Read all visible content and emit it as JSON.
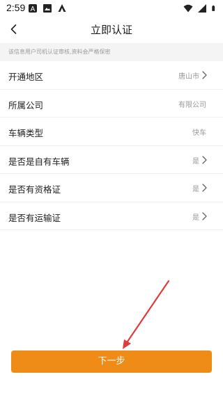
{
  "status_bar": {
    "time": "2:59",
    "left_icons": [
      "notification-icon",
      "image-icon",
      "app-icon"
    ],
    "right_icons": [
      "wifi-icon",
      "signal-icon",
      "battery-icon"
    ]
  },
  "header": {
    "title": "立即认证",
    "back_icon": "chevron-left-icon"
  },
  "notice": {
    "text": "该信息用户司机认证审核,资料会严格保密"
  },
  "form": {
    "rows": [
      {
        "label": "开通地区",
        "value": "唐山市",
        "has_arrow": true
      },
      {
        "label": "所属公司",
        "value": "有限公司",
        "has_arrow": false
      },
      {
        "label": "车辆类型",
        "value": "快车",
        "has_arrow": false
      },
      {
        "label": "是否是自有车辆",
        "value": "是",
        "has_arrow": true
      },
      {
        "label": "是否有资格证",
        "value": "是",
        "has_arrow": true
      },
      {
        "label": "是否有运输证",
        "value": "是",
        "has_arrow": true
      }
    ]
  },
  "footer": {
    "next_label": "下一步"
  },
  "colors": {
    "accent": "#ef8b17",
    "annotation_arrow": "#e03c3c",
    "notice_bg": "#f4f4f4"
  }
}
